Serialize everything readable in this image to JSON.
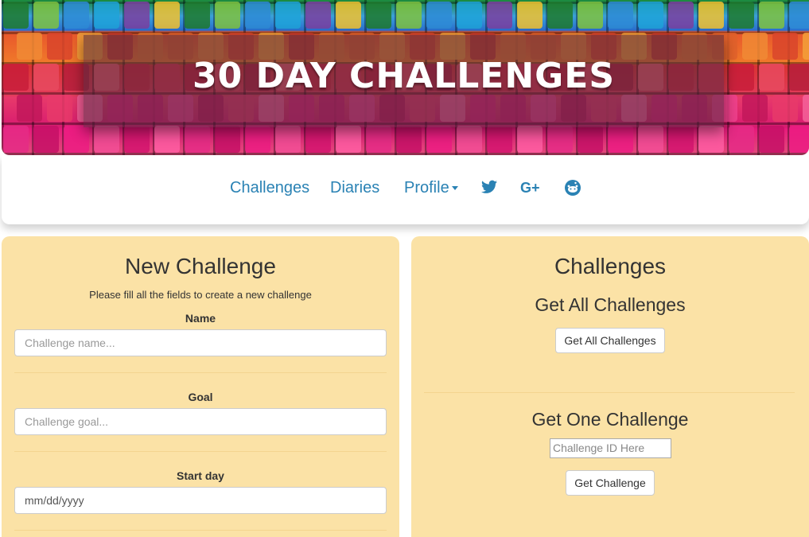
{
  "header": {
    "site_title": "30 DAY CHALLENGES"
  },
  "nav": {
    "challenges_label": "Challenges",
    "diaries_label": "Diaries",
    "profile_label": "Profile",
    "icons": [
      "twitter-icon",
      "google-plus-icon",
      "reddit-icon"
    ]
  },
  "new_challenge": {
    "title": "New Challenge",
    "help_text": "Please fill all the fields to create a new challenge",
    "name_label": "Name",
    "name_placeholder": "Challenge name...",
    "goal_label": "Goal",
    "goal_placeholder": "Challenge goal...",
    "start_label": "Start day",
    "start_value": "mm/dd/yyyy"
  },
  "challenges": {
    "title": "Challenges",
    "get_all_heading": "Get All Challenges",
    "get_all_button": "Get All Challenges",
    "get_one_heading": "Get One Challenge",
    "id_placeholder": "Challenge ID Here",
    "get_one_button": "Get Challenge"
  },
  "colors": {
    "panel_bg": "#fbe2a6",
    "link": "#2a82b4"
  }
}
